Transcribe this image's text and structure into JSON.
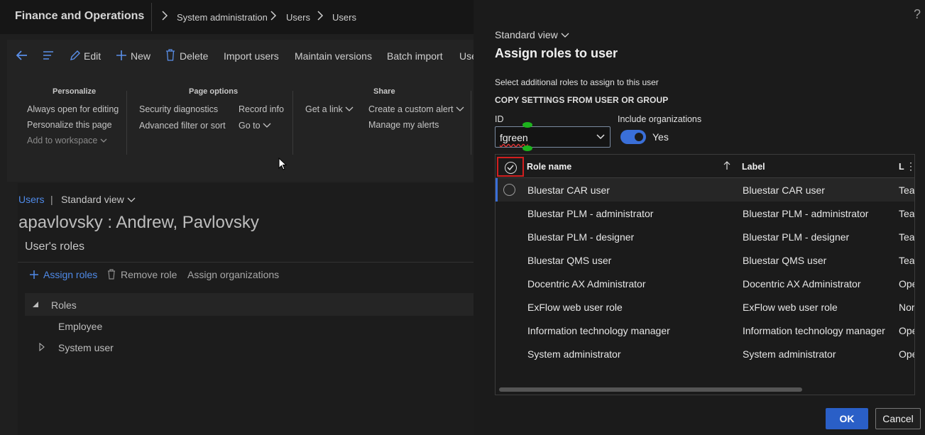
{
  "app": {
    "title": "Finance and Operations",
    "breadcrumbs": [
      "System administration",
      "Users",
      "Users"
    ]
  },
  "actions": {
    "edit": "Edit",
    "new": "New",
    "delete": "Delete",
    "import_users": "Import users",
    "maintain_versions": "Maintain versions",
    "batch_import": "Batch import",
    "truncated": "Use"
  },
  "ribbon": {
    "personalize": {
      "title": "Personalize",
      "always_open": "Always open for editing",
      "personalize_page": "Personalize this page",
      "add_workspace": "Add to workspace"
    },
    "page_options": {
      "title": "Page options",
      "security": "Security diagnostics",
      "advanced": "Advanced filter or sort",
      "record_info": "Record info",
      "go_to": "Go to"
    },
    "share": {
      "title": "Share",
      "get_link": "Get a link",
      "custom_alert": "Create a custom alert",
      "manage_alerts": "Manage my alerts"
    }
  },
  "record": {
    "users_link": "Users",
    "separator": "|",
    "view": "Standard view",
    "title": "apavlovsky : Andrew, Pavlovsky",
    "section": "User's roles",
    "assign_roles": "Assign roles",
    "remove_role": "Remove role",
    "assign_orgs": "Assign organizations",
    "tree": {
      "root": "Roles",
      "employee": "Employee",
      "system_user": "System user"
    }
  },
  "panel": {
    "help": "?",
    "view": "Standard view",
    "title": "Assign roles to user",
    "description": "Select additional roles to assign to this user",
    "copy_heading": "COPY SETTINGS FROM USER OR GROUP",
    "id_label": "ID",
    "id_value": "fgreen",
    "include_orgs_label": "Include organizations",
    "include_orgs_value": "Yes",
    "grid": {
      "col_role": "Role name",
      "col_label": "Label",
      "col_third": "L",
      "rows": [
        {
          "role": "Bluestar CAR user",
          "label": "Bluestar CAR user",
          "third": "Tea"
        },
        {
          "role": "Bluestar PLM - administrator",
          "label": "Bluestar PLM - administrator",
          "third": "Tea"
        },
        {
          "role": "Bluestar PLM - designer",
          "label": "Bluestar PLM - designer",
          "third": "Tea"
        },
        {
          "role": "Bluestar QMS user",
          "label": "Bluestar QMS user",
          "third": "Tea"
        },
        {
          "role": "Docentric AX Administrator",
          "label": "Docentric AX Administrator",
          "third": "Ope"
        },
        {
          "role": "ExFlow web user role",
          "label": "ExFlow web user role",
          "third": "Nor"
        },
        {
          "role": "Information technology manager",
          "label": "Information technology manager",
          "third": "Ope"
        },
        {
          "role": "System administrator",
          "label": "System administrator",
          "third": "Ope"
        }
      ]
    },
    "ok": "OK",
    "cancel": "Cancel"
  },
  "colors": {
    "accent": "#3a6fd8",
    "ok_button": "#2a5fc7",
    "highlight": "#d21f1f"
  }
}
